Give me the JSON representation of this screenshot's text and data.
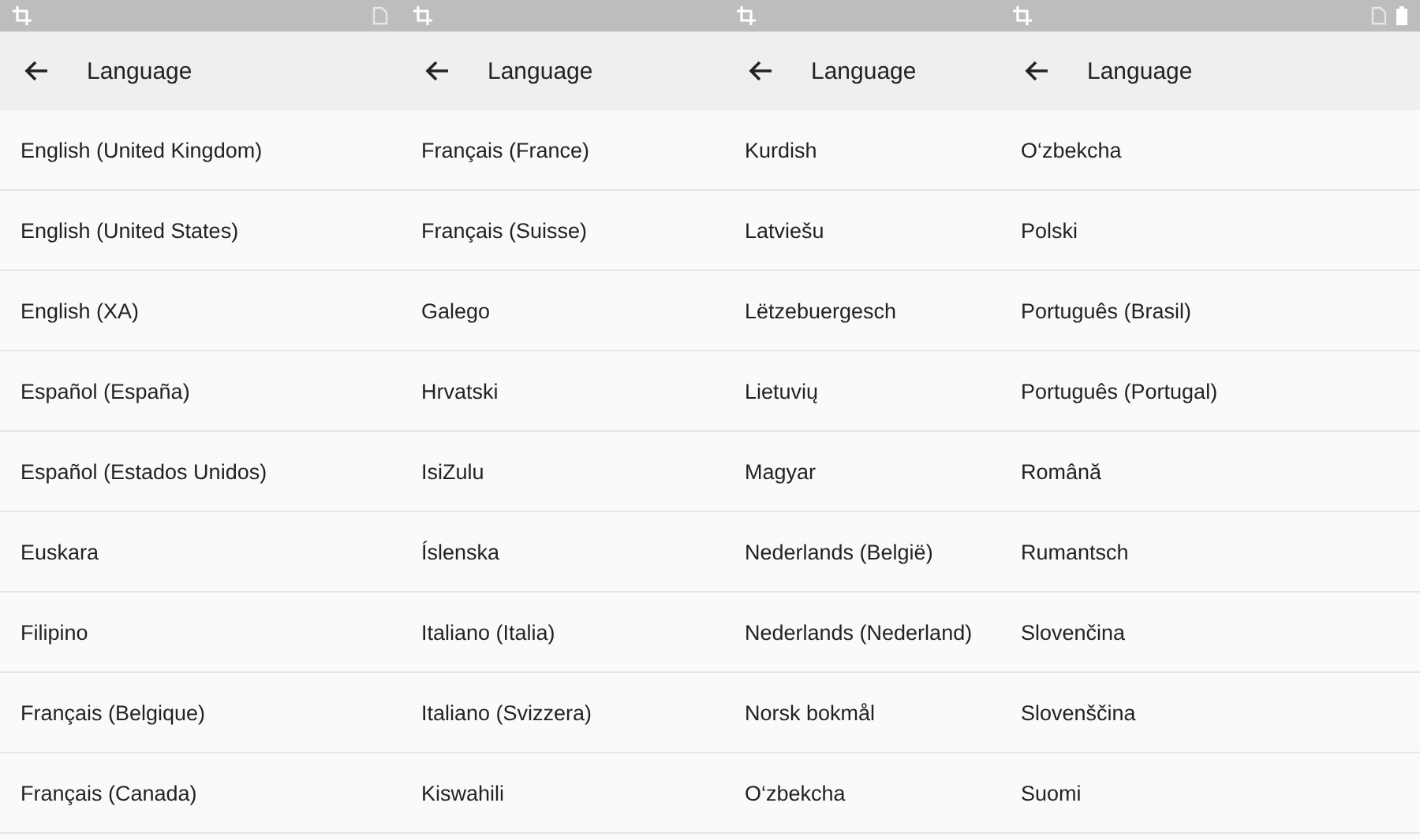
{
  "panels": [
    {
      "status_left": [
        {
          "kind": "crop"
        }
      ],
      "status_right": [
        {
          "kind": "sim"
        }
      ],
      "title": "Language",
      "items": [
        "English (United Kingdom)",
        "English (United States)",
        "English (XA)",
        "Español (España)",
        "Español (Estados Unidos)",
        "Euskara",
        "Filipino",
        "Français (Belgique)",
        "Français (Canada)"
      ]
    },
    {
      "status_left": [
        {
          "kind": "crop"
        }
      ],
      "title": "Language",
      "items": [
        "Français (France)",
        "Français (Suisse)",
        "Galego",
        "Hrvatski",
        "IsiZulu",
        "Íslenska",
        "Italiano (Italia)",
        "Italiano (Svizzera)",
        "Kiswahili"
      ]
    },
    {
      "status_left": [
        {
          "kind": "crop"
        }
      ],
      "title": "Language",
      "items": [
        "Kurdish",
        "Latviešu",
        "Lëtzebuergesch",
        "Lietuvių",
        "Magyar",
        "Nederlands (België)",
        "Nederlands (Nederland)",
        "Norsk bokmål",
        "O‘zbekcha"
      ]
    },
    {
      "status_left": [
        {
          "kind": "crop"
        }
      ],
      "status_right": [
        {
          "kind": "sim"
        },
        {
          "kind": "battery"
        }
      ],
      "title": "Language",
      "items": [
        "O‘zbekcha",
        "Polski",
        "Português (Brasil)",
        "Português (Portugal)",
        "Română",
        "Rumantsch",
        "Slovenčina",
        "Slovenščina",
        "Suomi"
      ]
    }
  ]
}
